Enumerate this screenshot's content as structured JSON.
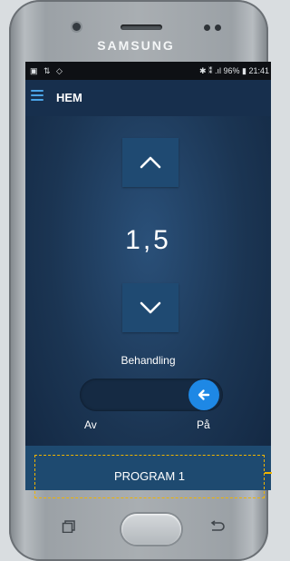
{
  "device": {
    "brand": "SAMSUNG"
  },
  "status_bar": {
    "left_icons": "▣ ⇅ ◇",
    "right": "✱ ⁑ .ıl 96% ▮ 21:41"
  },
  "app_bar": {
    "title": "HEM",
    "menu_icon": "hamburger-icon"
  },
  "controls": {
    "up_icon": "chevron-up-icon",
    "value": "1,5",
    "down_icon": "chevron-down-icon"
  },
  "treatment": {
    "label": "Behandling",
    "toggle_state": "on",
    "toggle_icon": "arrow-left-icon",
    "off_label": "Av",
    "on_label": "På"
  },
  "program": {
    "label": "PROGRAM 1",
    "highlight_color": "#f0b400"
  },
  "nav": {
    "recent_icon": "recent-apps-icon",
    "home_icon": "home-button",
    "back_icon": "back-icon"
  },
  "colors": {
    "accent": "#1e88e5",
    "app_bar": "#172f4d",
    "button": "#1f4a72"
  }
}
